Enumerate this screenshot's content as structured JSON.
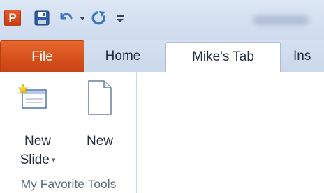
{
  "quick_access": {
    "app_icon_letter": "P",
    "items": [
      "powerpoint-app-icon",
      "save-icon",
      "undo-icon",
      "undo-dropdown-icon",
      "redo-icon",
      "customize-toolbar-icon"
    ]
  },
  "tabs": {
    "file": "File",
    "home": "Home",
    "mike": "Mike's Tab",
    "insert_partial": "Ins"
  },
  "group": {
    "label": "My Favorite Tools",
    "buttons": {
      "new_slide": {
        "line1": "New",
        "line2": "Slide",
        "dropdown": "▾"
      },
      "new": {
        "line1": "New"
      }
    }
  },
  "colors": {
    "file_tab": "#d54e1a",
    "titlebar": "#d4e0f1",
    "ribbon_border": "#a9bdd6"
  }
}
